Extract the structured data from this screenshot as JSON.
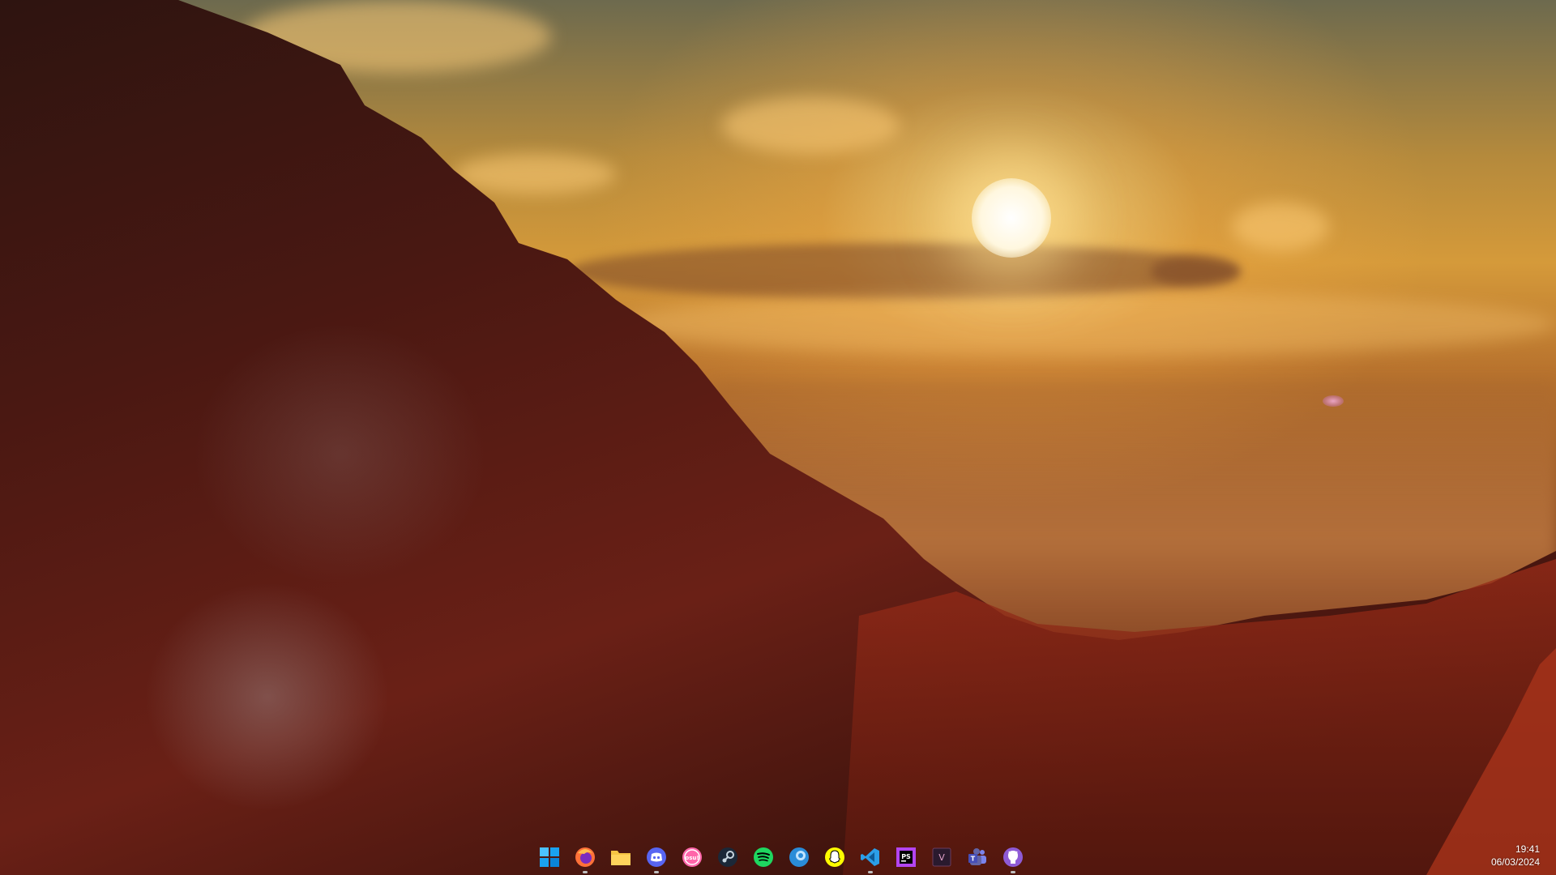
{
  "desktop": {
    "wallpaper": "autumn-forest-sunset",
    "colors": {
      "hill_dark": "#3a1510",
      "hill_red": "#8a2618",
      "sky_gold": "#d59a3a",
      "sun": "#ffffff"
    }
  },
  "taskbar": {
    "apps": [
      {
        "name": "start",
        "icon": "windows-start-icon",
        "color": "#4cc2ff",
        "active": false
      },
      {
        "name": "firefox",
        "icon": "firefox-icon",
        "color": "#ff7139",
        "active": true
      },
      {
        "name": "file-explorer",
        "icon": "folder-icon",
        "color": "#f6c444",
        "active": false
      },
      {
        "name": "discord",
        "icon": "discord-icon",
        "color": "#5865f2",
        "active": true
      },
      {
        "name": "osu",
        "icon": "osu-icon",
        "color": "#ff66aa",
        "label": "osu!",
        "active": false
      },
      {
        "name": "steam",
        "icon": "steam-icon",
        "color": "#1b2838",
        "active": false
      },
      {
        "name": "spotify",
        "icon": "spotify-icon",
        "color": "#1ed760",
        "active": false
      },
      {
        "name": "browser-blue",
        "icon": "globe-icon",
        "color": "#2a8cd8",
        "active": false
      },
      {
        "name": "snapchat",
        "icon": "snapchat-icon",
        "color": "#fffc00",
        "active": false
      },
      {
        "name": "vscode",
        "icon": "vscode-icon",
        "color": "#2b9ee8",
        "active": true
      },
      {
        "name": "phpstorm",
        "icon": "phpstorm-icon",
        "color": "#b345f1",
        "label": "PS",
        "active": false
      },
      {
        "name": "vim-app",
        "icon": "v-app-icon",
        "color": "#2a1a2e",
        "label": "V",
        "active": false
      },
      {
        "name": "teams",
        "icon": "teams-icon",
        "color": "#6264a7",
        "active": false
      },
      {
        "name": "github",
        "icon": "github-icon",
        "color": "#8e5bd6",
        "active": true
      }
    ],
    "clock": {
      "time": "19:41",
      "date": "06/03/2024"
    }
  }
}
